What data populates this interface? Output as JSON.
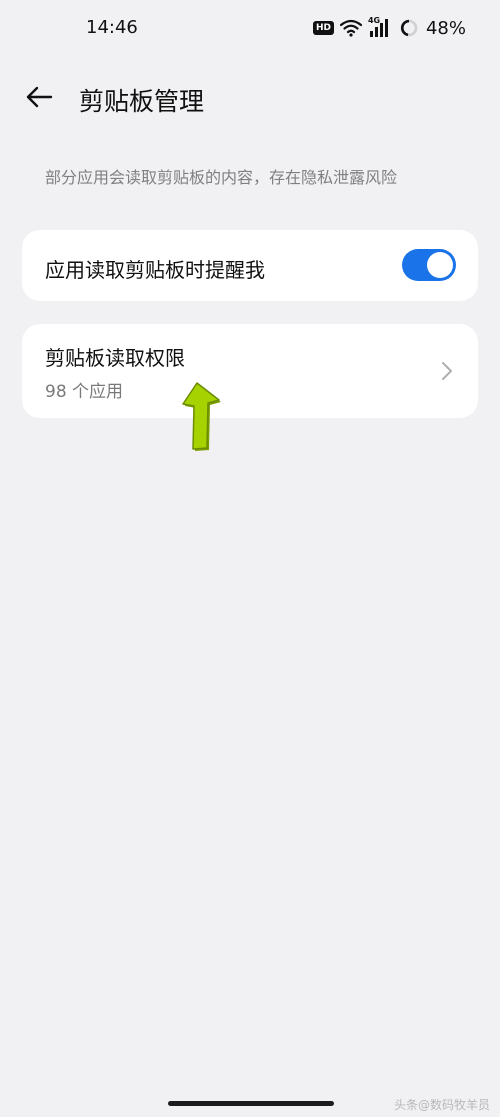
{
  "status_bar": {
    "time": "14:46",
    "hd_badge": "HD",
    "network": "4G",
    "battery": "48%"
  },
  "header": {
    "title": "剪贴板管理"
  },
  "description": "部分应用会读取剪贴板的内容，存在隐私泄露风险",
  "settings": {
    "notify_toggle": {
      "label": "应用读取剪贴板时提醒我",
      "enabled": true
    },
    "permission": {
      "label": "剪贴板读取权限",
      "sub": "98 个应用"
    }
  },
  "watermark": "头条@数码牧羊员",
  "colors": {
    "background": "#f1f1f4",
    "card": "#ffffff",
    "accent": "#1a73e8",
    "annotation_arrow": "#a6d300"
  },
  "icons": {
    "back": "arrow-left-icon",
    "chevron": "chevron-right-icon",
    "wifi": "wifi-icon",
    "signal": "signal-icon",
    "battery": "battery-ring-icon",
    "annotation": "green-up-arrow-icon"
  }
}
